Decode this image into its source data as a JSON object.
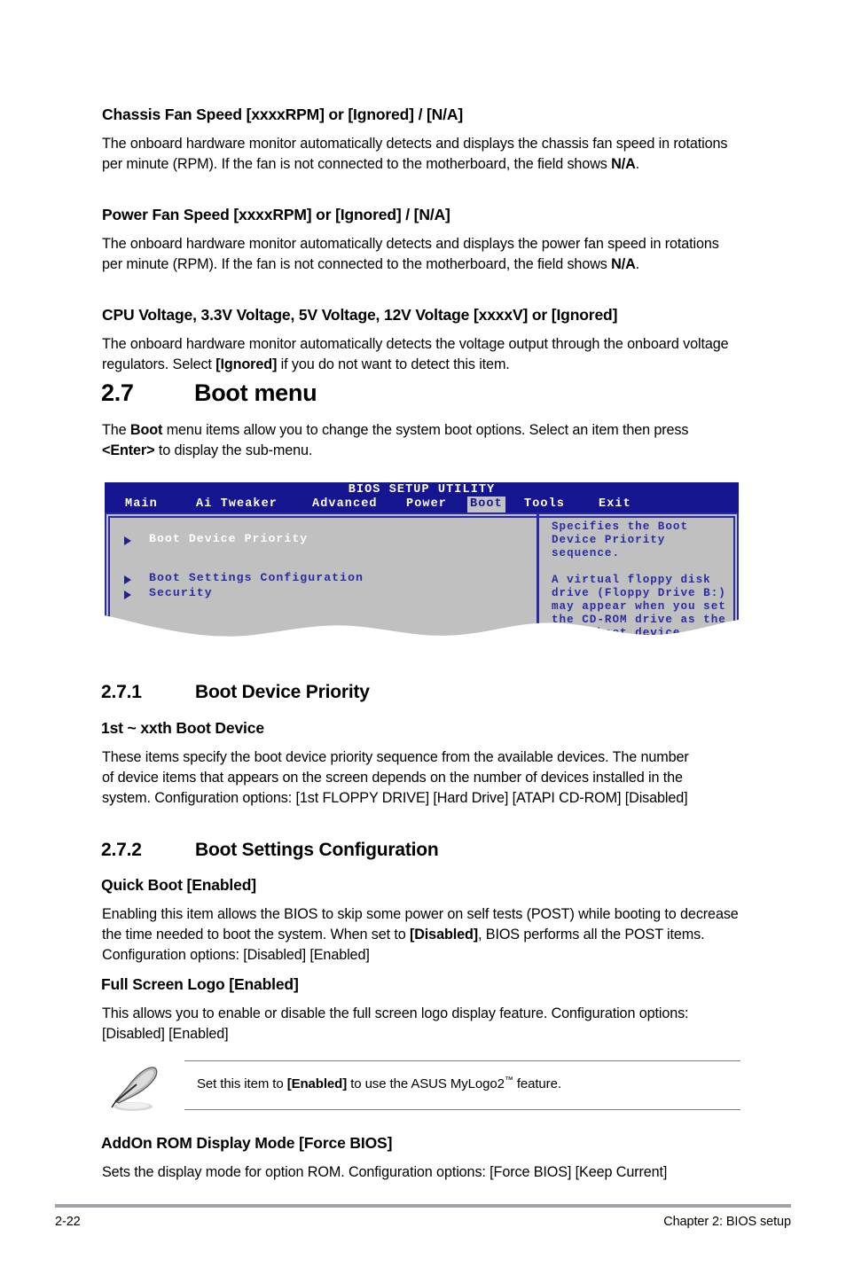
{
  "sections": [
    {
      "heading": "Chassis Fan Speed [xxxxRPM] or [Ignored] / [N/A]",
      "body_pre": "The onboard hardware monitor automatically detects and displays the chassis fan speed in rotations per minute (RPM). If the fan is not connected to the motherboard, the field shows ",
      "body_bold": "N/A",
      "body_post": "."
    },
    {
      "heading": "Power Fan Speed [xxxxRPM] or [Ignored] / [N/A]",
      "body_pre": "The onboard hardware monitor automatically detects and displays the power fan speed in rotations per minute (RPM). If the fan is not connected to the motherboard, the field shows ",
      "body_bold": "N/A",
      "body_post": "."
    },
    {
      "heading": "CPU Voltage, 3.3V Voltage, 5V Voltage, 12V Voltage [xxxxV] or [Ignored]",
      "body_pre": "The onboard hardware monitor automatically detects the voltage output through the onboard voltage regulators. Select ",
      "body_bold": "[Ignored]",
      "body_post": " if you do not want to detect this item."
    }
  ],
  "boot_menu": {
    "number": "2.7",
    "title": "Boot menu",
    "intro_pre": "The ",
    "intro_bold1": "Boot",
    "intro_mid": " menu items allow you to change the system boot options. Select an item then press ",
    "intro_bold2": "<Enter>",
    "intro_post": " to display the sub-menu."
  },
  "bios": {
    "title": "BIOS SETUP UTILITY",
    "tabs": [
      {
        "label": "Main",
        "selected": false
      },
      {
        "label": "Ai Tweaker",
        "selected": false
      },
      {
        "label": "Advanced",
        "selected": false
      },
      {
        "label": "Power",
        "selected": false
      },
      {
        "label": "Boot",
        "selected": true
      },
      {
        "label": "Tools",
        "selected": false
      },
      {
        "label": "Exit",
        "selected": false
      }
    ],
    "items": [
      {
        "label": "Boot Device Priority",
        "highlighted": true
      },
      {
        "label": "Boot Settings Configuration",
        "highlighted": false
      },
      {
        "label": "Security",
        "highlighted": false
      }
    ],
    "help_lines": [
      "Specifies the Boot",
      "Device Priority",
      "sequence.",
      "",
      "A virtual floppy disk",
      "drive (Floppy Drive B:)",
      "may appear when you set",
      "the CD-ROM drive as the",
      "first boot device."
    ],
    "colors": {
      "header_blue": "#15158f",
      "body_grey": "#c0c0c0",
      "text_blue": "#2a2aa5",
      "highlight_text": "#ffffff"
    }
  },
  "boot_device_priority": {
    "number": "2.7.1",
    "title": "Boot Device Priority",
    "sub_heading": "1st ~ xxth Boot Device",
    "body": "These items specify the boot device priority sequence from the available devices. The number of device items that appears on the screen depends on the number of devices installed in the system. Configuration options: [1st FLOPPY DRIVE] [Hard Drive] [ATAPI CD-ROM] [Disabled]"
  },
  "boot_settings_configuration": {
    "number": "2.7.2",
    "title": "Boot Settings Configuration",
    "quick_boot": {
      "heading": "Quick Boot [Enabled]",
      "body_pre": "Enabling this item allows the BIOS to skip some power on self tests (POST) while booting to decrease the time needed to boot the system. When set to ",
      "body_bold": "[Disabled]",
      "body_post": ", BIOS performs all the POST items. Configuration options: [Disabled] [Enabled]"
    },
    "full_screen_logo": {
      "heading": "Full Screen Logo [Enabled]",
      "body": "This allows you to enable or disable the full screen logo display feature. Configuration options: [Disabled] [Enabled]"
    },
    "note": {
      "pre": "Set this item to ",
      "bold": "[Enabled]",
      "mid": " to use the ASUS MyLogo2",
      "tm": "™",
      "post": " feature."
    },
    "addon_rom": {
      "heading": "AddOn ROM Display Mode [Force BIOS]",
      "body": "Sets the display mode for option ROM. Configuration options: [Force BIOS] [Keep Current]"
    }
  },
  "footer": {
    "page_number": "2-22",
    "chapter": "Chapter 2: BIOS setup"
  }
}
